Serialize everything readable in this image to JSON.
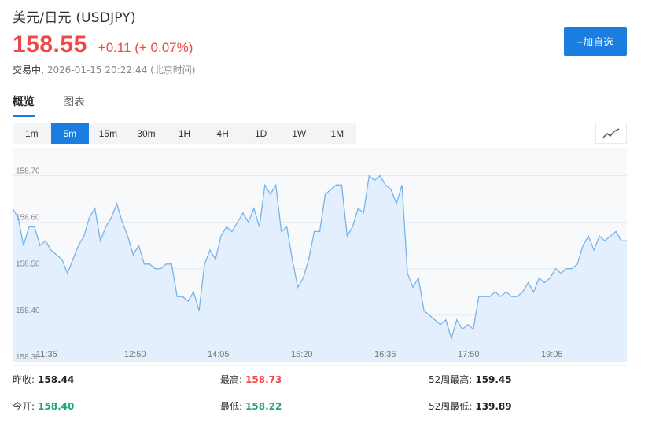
{
  "header": {
    "title": "美元/日元  (USDJPY)",
    "price": "158.55",
    "change": "+0.11 (+ 0.07%)",
    "status": "交易中,",
    "timestamp": "2026-01-15 20:22:44 (北京时间)",
    "add_label": "+加自选"
  },
  "colors": {
    "up": "#f04848",
    "down": "#22a37a",
    "accent": "#1a7ee0",
    "line": "#7ab3ea",
    "fill": "#e3effc"
  },
  "tabs": [
    {
      "label": "概览",
      "active": true
    },
    {
      "label": "图表",
      "active": false
    }
  ],
  "intervals": [
    {
      "label": "1m"
    },
    {
      "label": "5m",
      "active": true
    },
    {
      "label": "15m"
    },
    {
      "label": "30m"
    },
    {
      "label": "1H"
    },
    {
      "label": "4H"
    },
    {
      "label": "1D"
    },
    {
      "label": "1W"
    },
    {
      "label": "1M"
    }
  ],
  "chart_type_icon": "line-chart-icon",
  "chart_data": {
    "type": "area",
    "x_ticks": [
      "11:35",
      "12:50",
      "14:05",
      "15:20",
      "16:35",
      "17:50",
      "19:05"
    ],
    "y_ticks": [
      "158.70",
      "158.60",
      "158.50",
      "158.40",
      "158.30"
    ],
    "ylim": [
      158.3,
      158.76
    ],
    "grid": true,
    "values": [
      158.63,
      158.61,
      158.55,
      158.59,
      158.59,
      158.55,
      158.56,
      158.54,
      158.53,
      158.52,
      158.49,
      158.52,
      158.55,
      158.57,
      158.61,
      158.63,
      158.56,
      158.59,
      158.61,
      158.64,
      158.6,
      158.57,
      158.53,
      158.55,
      158.51,
      158.51,
      158.5,
      158.5,
      158.51,
      158.51,
      158.44,
      158.44,
      158.43,
      158.45,
      158.41,
      158.51,
      158.54,
      158.52,
      158.57,
      158.59,
      158.58,
      158.6,
      158.62,
      158.6,
      158.63,
      158.59,
      158.68,
      158.66,
      158.68,
      158.58,
      158.59,
      158.52,
      158.46,
      158.48,
      158.52,
      158.58,
      158.58,
      158.66,
      158.67,
      158.68,
      158.68,
      158.57,
      158.59,
      158.63,
      158.62,
      158.7,
      158.69,
      158.7,
      158.68,
      158.67,
      158.64,
      158.68,
      158.49,
      158.46,
      158.48,
      158.41,
      158.4,
      158.39,
      158.38,
      158.39,
      158.35,
      158.39,
      158.37,
      158.38,
      158.37,
      158.44,
      158.44,
      158.44,
      158.45,
      158.44,
      158.45,
      158.44,
      158.44,
      158.45,
      158.47,
      158.45,
      158.48,
      158.47,
      158.48,
      158.5,
      158.49,
      158.5,
      158.5,
      158.51,
      158.55,
      158.57,
      158.54,
      158.57,
      158.56,
      158.57,
      158.58,
      158.56,
      158.56
    ]
  },
  "stats": [
    {
      "label": "昨收:",
      "value": "158.44",
      "tone": "neutral"
    },
    {
      "label": "最高:",
      "value": "158.73",
      "tone": "up"
    },
    {
      "label": "52周最高:",
      "value": "159.45",
      "tone": "neutral"
    },
    {
      "label": "今开:",
      "value": "158.40",
      "tone": "down"
    },
    {
      "label": "最低:",
      "value": "158.22",
      "tone": "down"
    },
    {
      "label": "52周最低:",
      "value": "139.89",
      "tone": "neutral"
    }
  ]
}
